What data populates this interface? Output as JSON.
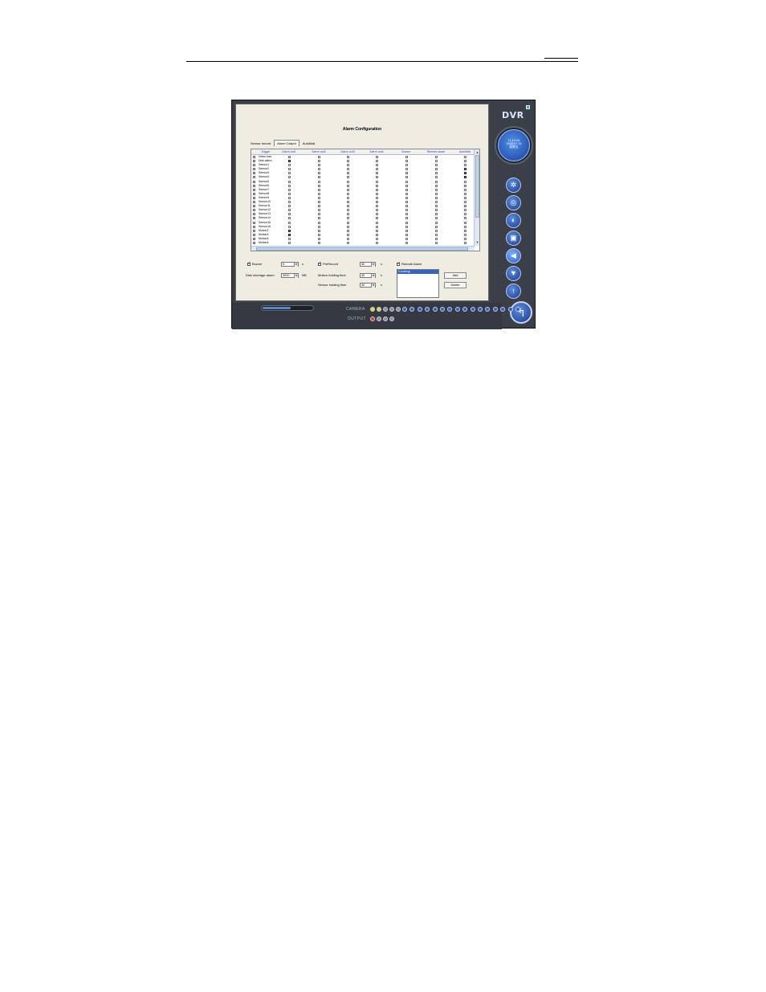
{
  "dialog": {
    "title": "Alarm Configuration",
    "tabs": [
      {
        "label": "Sensor record",
        "active": false
      },
      {
        "label": "Alarm Output",
        "active": true
      },
      {
        "label": "AutoMail",
        "active": false
      }
    ]
  },
  "grid": {
    "columns": [
      "Trigger",
      "Alarm out1",
      "Alarm out2",
      "Alarm out3",
      "Alarm out4",
      "Buzzer",
      "Remote alarm",
      "AutoMail"
    ],
    "rows": [
      {
        "label": "Video loss",
        "checked": []
      },
      {
        "label": "Disk alarm",
        "checked": [
          0
        ]
      },
      {
        "label": "Sensor1",
        "checked": []
      },
      {
        "label": "Sensor2",
        "checked": [
          6
        ]
      },
      {
        "label": "Sensor3",
        "checked": [
          6
        ]
      },
      {
        "label": "Sensor4",
        "checked": [
          6
        ]
      },
      {
        "label": "Sensor5",
        "checked": []
      },
      {
        "label": "Sensor6",
        "checked": []
      },
      {
        "label": "Sensor7",
        "checked": []
      },
      {
        "label": "Sensor8",
        "checked": []
      },
      {
        "label": "Sensor9",
        "checked": []
      },
      {
        "label": "Sensor10",
        "checked": []
      },
      {
        "label": "Sensor11",
        "checked": []
      },
      {
        "label": "Sensor12",
        "checked": []
      },
      {
        "label": "Sensor13",
        "checked": []
      },
      {
        "label": "Sensor14",
        "checked": []
      },
      {
        "label": "Sensor15",
        "checked": []
      },
      {
        "label": "Sensor16",
        "checked": []
      },
      {
        "label": "Motion2",
        "checked": [
          0
        ]
      },
      {
        "label": "Motion3",
        "checked": [
          0
        ]
      },
      {
        "label": "Motion5",
        "checked": []
      },
      {
        "label": "Motion6",
        "checked": []
      }
    ]
  },
  "settings": {
    "buzzer": {
      "label": "Buzzer",
      "checked": true,
      "value": "5",
      "unit": "s"
    },
    "disk_shortage": {
      "label": "Disk shortage alarm",
      "value": "3000",
      "unit": "MB"
    },
    "prerecord": {
      "label": "PreRecord",
      "checked": true,
      "value": "30",
      "unit": "s"
    },
    "motion_holding": {
      "label": "Motion holding time",
      "value": "30",
      "unit": "s"
    },
    "sensor_holding": {
      "label": "Sensor holding time",
      "value": "30",
      "unit": "s"
    },
    "remote_alarm": {
      "label": "Remote Alarm",
      "checked": true,
      "items": [
        "Coodong"
      ]
    },
    "add_label": "Add",
    "delete_label": "Delete"
  },
  "side": {
    "brand": "DVR",
    "time": "11:12:26",
    "date": "2005.07.15",
    "weekday": "星期五"
  },
  "bottom": {
    "camera_label": "CAMERA",
    "output_label": "OUTPUT",
    "progress": 0.55,
    "camera_leds": [
      "yellow",
      "yellow",
      "grey",
      "grey",
      "grey",
      "blue",
      "blue",
      "blue",
      "blue",
      "blue",
      "blue",
      "blue",
      "blue",
      "blue",
      "blue",
      "blue",
      "blue",
      "blue",
      "blue",
      "blue",
      "blue"
    ],
    "output_leds": [
      "red",
      "grey",
      "grey",
      "grey"
    ]
  }
}
